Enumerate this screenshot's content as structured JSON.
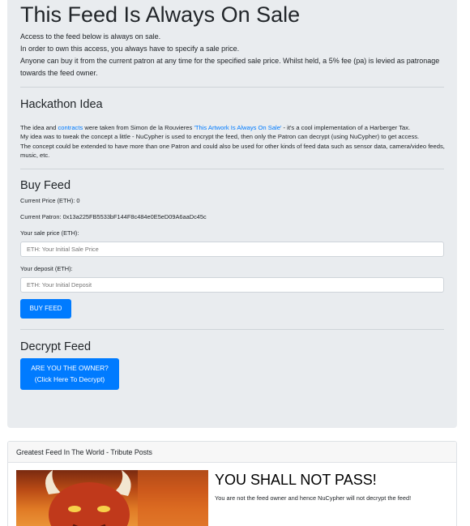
{
  "page": {
    "title": "This Feed Is Always On Sale",
    "intro": [
      "Access to the feed below is always on sale.",
      "In order to own this access, you always have to specify a sale price.",
      "Anyone can buy it from the current patron at any time for the specified sale price. Whilst held, a 5% fee (pa) is levied as patronage towards the feed owner."
    ]
  },
  "idea": {
    "title": "Hackathon Idea",
    "p1_a": "The idea and ",
    "p1_link1": "contracts",
    "p1_b": " were taken from Simon de la Rouvieres ",
    "p1_link2": "'This Artwork Is Always On Sale'",
    "p1_c": " - it's a cool implementation of a Harberger Tax.",
    "p2": "My idea was to tweak the concept a little - NuCypher is used to encrypt the feed, then only the Patron can decrypt (using NuCypher) to get access.",
    "p3": "The concept could be extended to have more than one Patron and could also be used for other kinds of feed data such as sensor data, camera/video feeds, music, etc."
  },
  "buy": {
    "title": "Buy Feed",
    "current_price": "Current Price (ETH): 0",
    "current_patron": "Current Patron: 0x13a225FB5533bF144F8c484e0E5eD09A6aaDc45c",
    "sale_price_label": "Your sale price (ETH):",
    "sale_price_placeholder": "ETH: Your Initial Sale Price",
    "deposit_label": "Your deposit (ETH):",
    "deposit_placeholder": "ETH: Your Initial Deposit",
    "button": "BUY FEED"
  },
  "decrypt": {
    "title": "Decrypt Feed",
    "button_line1": "ARE YOU THE OWNER?",
    "button_line2": "(Click Here To Decrypt)"
  },
  "feed": {
    "header": "Greatest Feed In The World - Tribute Posts",
    "post_title": "YOU SHALL NOT PASS!",
    "post_text": "You are not the feed owner and hence NuCypher will not decrypt the feed!"
  },
  "colors": {
    "primary": "#007bff",
    "jumbotron_bg": "#e9ecef"
  }
}
